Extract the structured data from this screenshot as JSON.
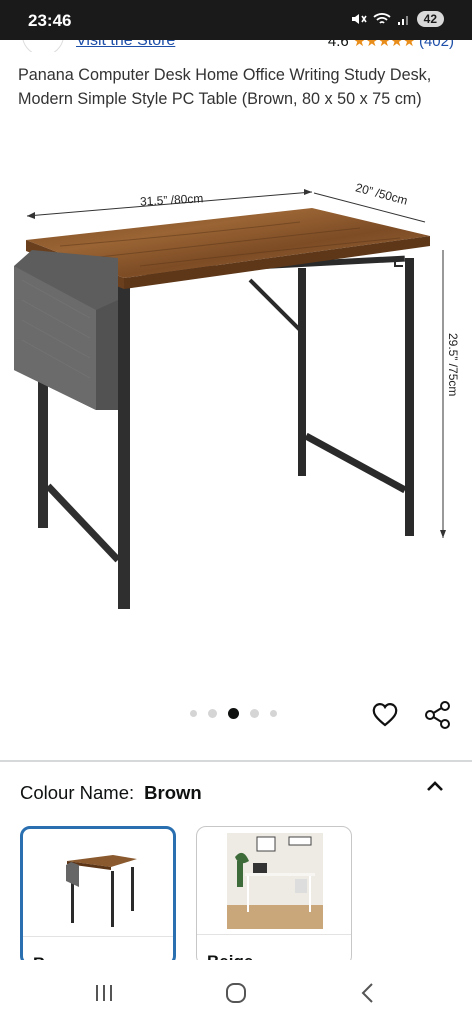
{
  "status_bar": {
    "time": "23:46",
    "battery": "42",
    "icons": [
      "mute-icon",
      "wifi-icon",
      "signal-icon"
    ]
  },
  "store": {
    "link_label": "Visit the Store",
    "rating_value": "4.6",
    "stars": "★★★★★",
    "rating_count": "(402)"
  },
  "product": {
    "title": "Panana Computer Desk Home Office Writing Study Desk, Modern Simple Style PC Table (Brown, 80 x 50 x 75 cm)",
    "dimensions": {
      "width": "31.5” /80cm",
      "depth": "20” /50cm",
      "height": "29.5” /75cm"
    }
  },
  "carousel": {
    "count": 5,
    "active_index": 2
  },
  "colour": {
    "label": "Colour Name:",
    "selected": "Brown",
    "options": [
      {
        "label": "Brown"
      },
      {
        "label": "Beige"
      }
    ]
  },
  "colors": {
    "accent": "#2a6fb0",
    "link": "#1d4ea8",
    "star": "#e88c1a"
  }
}
